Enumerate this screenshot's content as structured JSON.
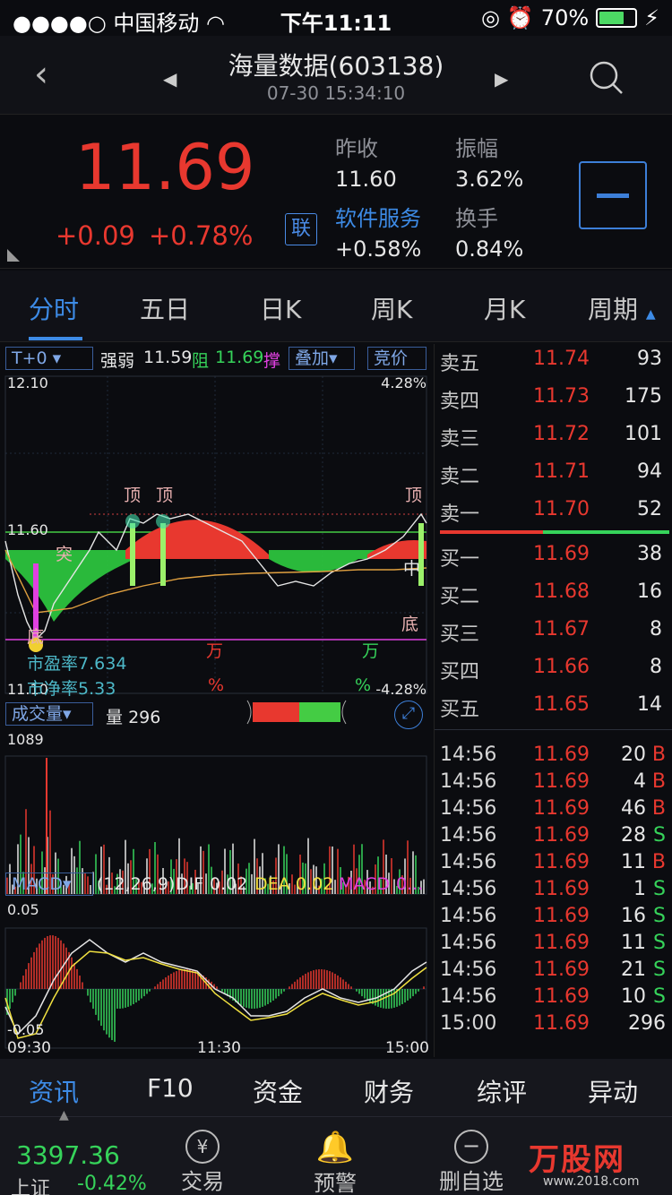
{
  "status": {
    "carrier": "中国移动",
    "time": "下午11:11",
    "battery": "70%"
  },
  "nav": {
    "title": "海量数据(603138)",
    "datetime": "07-30 15:34:10"
  },
  "quote": {
    "price": "11.69",
    "change": "+0.09",
    "change_pct": "+0.78%",
    "lian": "联",
    "prev_close_label": "昨收",
    "prev_close": "11.60",
    "amplitude_label": "振幅",
    "amplitude": "3.62%",
    "sector_label": "软件服务",
    "sector_change": "+0.58%",
    "turnover_label": "换手",
    "turnover": "0.84%"
  },
  "tabs": [
    "分时",
    "五日",
    "日K",
    "周K",
    "月K",
    "周期"
  ],
  "chart": {
    "t0_select": "T+0",
    "strength_label": "强弱",
    "strength_val": "11.59",
    "resist_label": "阻",
    "resist_val": "11.69",
    "support_label": "撑",
    "overlay": "叠加",
    "auction": "竞价",
    "y_top": "12.10",
    "y_mid": "11.60",
    "y_bottom": "11.10",
    "pct_top": "4.28%",
    "pct_bottom": "-4.28%",
    "pe_label": "市盈率",
    "pe_val": "7.634",
    "pb_label": "市净率",
    "pb_val": "5.33",
    "wan1": "万",
    "wan2": "万",
    "pct1": "%",
    "pct2": "%",
    "mark_top": "顶",
    "mark_bottom": "底",
    "mark_mid": "中",
    "mark_tu": "突",
    "vol_select": "成交量",
    "vol_label": "量",
    "vol_val": "296",
    "vol_max": "1089",
    "macd_select": "MACD",
    "macd_params": "(12,26,9)",
    "dif_label": "DIF",
    "dif_val": "0.02",
    "dea_label": "DEA",
    "dea_val": "0.02",
    "macd_label": "MACD",
    "macd_val": "0...",
    "macd_top": "0.05",
    "macd_bottom": "-0.05",
    "times": [
      "09:30",
      "11:30",
      "15:00"
    ]
  },
  "book": {
    "asks": [
      {
        "name": "卖五",
        "price": "11.74",
        "vol": "93"
      },
      {
        "name": "卖四",
        "price": "11.73",
        "vol": "175"
      },
      {
        "name": "卖三",
        "price": "11.72",
        "vol": "101"
      },
      {
        "name": "卖二",
        "price": "11.71",
        "vol": "94"
      },
      {
        "name": "卖一",
        "price": "11.70",
        "vol": "52"
      }
    ],
    "bids": [
      {
        "name": "买一",
        "price": "11.69",
        "vol": "38"
      },
      {
        "name": "买二",
        "price": "11.68",
        "vol": "16"
      },
      {
        "name": "买三",
        "price": "11.67",
        "vol": "8"
      },
      {
        "name": "买四",
        "price": "11.66",
        "vol": "8"
      },
      {
        "name": "买五",
        "price": "11.65",
        "vol": "14"
      }
    ],
    "trades": [
      {
        "time": "14:56",
        "price": "11.69",
        "vol": "20",
        "side": "B"
      },
      {
        "time": "14:56",
        "price": "11.69",
        "vol": "4",
        "side": "B"
      },
      {
        "time": "14:56",
        "price": "11.69",
        "vol": "46",
        "side": "B"
      },
      {
        "time": "14:56",
        "price": "11.69",
        "vol": "28",
        "side": "S"
      },
      {
        "time": "14:56",
        "price": "11.69",
        "vol": "11",
        "side": "B"
      },
      {
        "time": "14:56",
        "price": "11.69",
        "vol": "1",
        "side": "S"
      },
      {
        "time": "14:56",
        "price": "11.69",
        "vol": "16",
        "side": "S"
      },
      {
        "time": "14:56",
        "price": "11.69",
        "vol": "11",
        "side": "S"
      },
      {
        "time": "14:56",
        "price": "11.69",
        "vol": "21",
        "side": "S"
      },
      {
        "time": "14:56",
        "price": "11.69",
        "vol": "10",
        "side": "S"
      },
      {
        "time": "15:00",
        "price": "11.69",
        "vol": "296",
        "side": ""
      }
    ]
  },
  "bottom_tabs": [
    "资讯",
    "F10",
    "资金",
    "财务",
    "综评",
    "异动"
  ],
  "footer": {
    "index_val": "3397.36",
    "index_name": "上证",
    "index_pct": "-0.42%",
    "trade": "交易",
    "alert": "预警",
    "delete": "删自选",
    "watermark": "万股网",
    "watermark_url": "www.2018.com"
  },
  "colors": {
    "up": "#e8382f",
    "down": "#36d35a",
    "accent": "#3d8be6"
  }
}
